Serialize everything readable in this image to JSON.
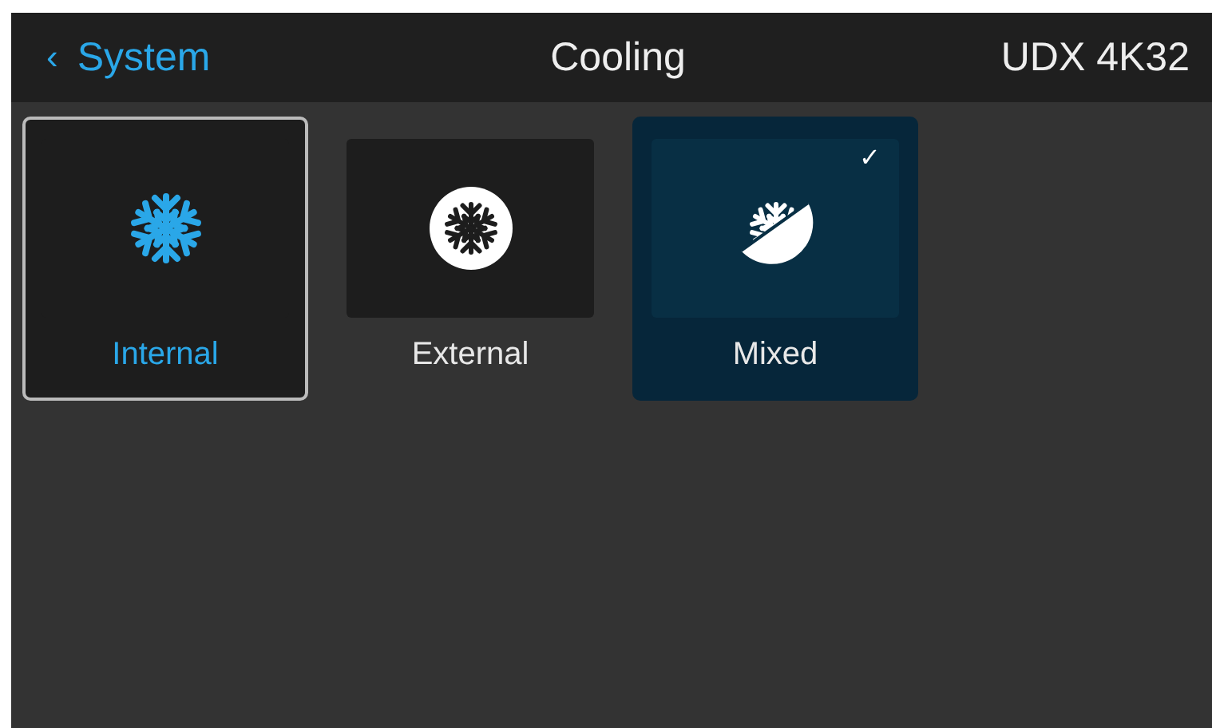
{
  "header": {
    "back_icon": "‹",
    "back_label": "System",
    "title": "Cooling",
    "device": "UDX 4K32"
  },
  "options": [
    {
      "label": "Internal",
      "kind": "plain",
      "focused": true,
      "selected": false
    },
    {
      "label": "External",
      "kind": "circle",
      "focused": false,
      "selected": false
    },
    {
      "label": "Mixed",
      "kind": "half",
      "focused": false,
      "selected": true
    }
  ],
  "check_mark": "✓"
}
